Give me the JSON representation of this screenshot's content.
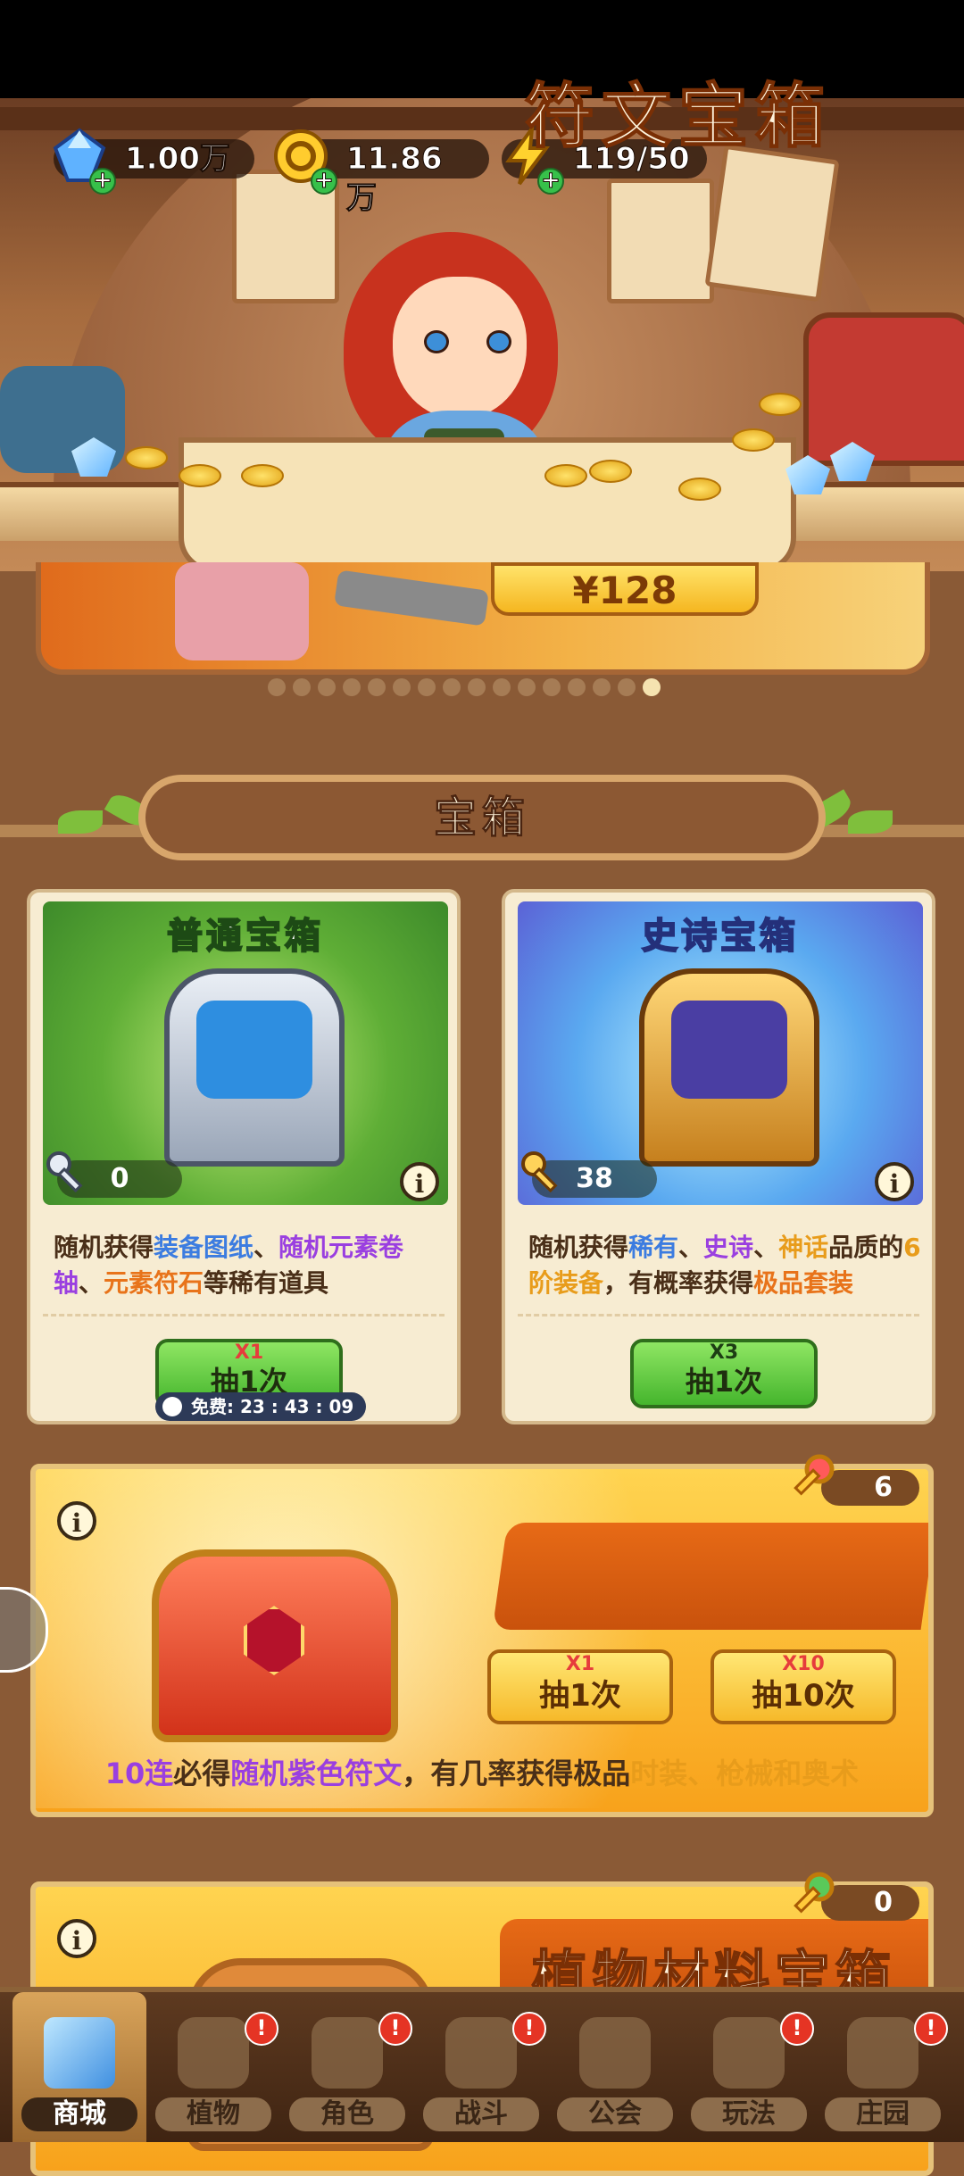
{
  "currency": {
    "gems": "1.00万",
    "gold": "11.86万",
    "energy": "119/50"
  },
  "promo": {
    "price": "¥128",
    "page_count": 16,
    "active_page": 16
  },
  "section": {
    "title": "宝箱"
  },
  "cards": [
    {
      "title": "普通宝箱",
      "key_count": "0",
      "description_parts": [
        {
          "text": "随机获得",
          "style": "plain"
        },
        {
          "text": "装备图纸",
          "style": "blue"
        },
        {
          "text": "、",
          "style": "plain"
        },
        {
          "text": "随机元素卷轴",
          "style": "purple"
        },
        {
          "text": "、",
          "style": "plain"
        },
        {
          "text": "元素符石",
          "style": "orange"
        },
        {
          "text": "等稀有道具",
          "style": "plain"
        }
      ],
      "button": {
        "cost": "X1",
        "label": "抽1次"
      },
      "timer": "免费: 23 : 43 : 09"
    },
    {
      "title": "史诗宝箱",
      "key_count": "38",
      "description_parts": [
        {
          "text": "随机获得",
          "style": "plain"
        },
        {
          "text": "稀有",
          "style": "blue"
        },
        {
          "text": "、",
          "style": "plain"
        },
        {
          "text": "史诗",
          "style": "purple"
        },
        {
          "text": "、",
          "style": "plain"
        },
        {
          "text": "神话",
          "style": "gold"
        },
        {
          "text": "品质的",
          "style": "plain"
        },
        {
          "text": "6阶装备",
          "style": "gold"
        },
        {
          "text": "，有概率获得",
          "style": "plain"
        },
        {
          "text": "极品套装",
          "style": "orange"
        }
      ],
      "button": {
        "cost": "X3",
        "label": "抽1次"
      }
    }
  ],
  "rune_chest": {
    "title": "符文宝箱",
    "key_count": "6",
    "button_single": {
      "cost": "X1",
      "label": "抽1次"
    },
    "button_ten": {
      "cost": "X10",
      "label": "抽10次"
    },
    "description_parts": [
      {
        "text": "10连",
        "style": "purple"
      },
      {
        "text": "必得",
        "style": "plain"
      },
      {
        "text": "随机紫色符文",
        "style": "purple"
      },
      {
        "text": "，有几率获得极品",
        "style": "plain"
      },
      {
        "text": "时装、枪械和奥术",
        "style": "gold"
      }
    ]
  },
  "plant_chest": {
    "title": "植物材料宝箱",
    "key_count": "0"
  },
  "nav": [
    {
      "label": "商城",
      "active": true,
      "badge": false
    },
    {
      "label": "植物",
      "active": false,
      "badge": true
    },
    {
      "label": "角色",
      "active": false,
      "badge": true
    },
    {
      "label": "战斗",
      "active": false,
      "badge": true
    },
    {
      "label": "公会",
      "active": false,
      "badge": false
    },
    {
      "label": "玩法",
      "active": false,
      "badge": true
    },
    {
      "label": "庄园",
      "active": false,
      "badge": true
    }
  ],
  "badge_symbol": "!",
  "info_symbol": "i",
  "colors": {
    "highlight_blue": "#3c7ce0",
    "highlight_purple": "#9a3fe0",
    "highlight_orange": "#e8731a",
    "highlight_gold": "#e89c1b",
    "nav_badge": "#e53424"
  }
}
